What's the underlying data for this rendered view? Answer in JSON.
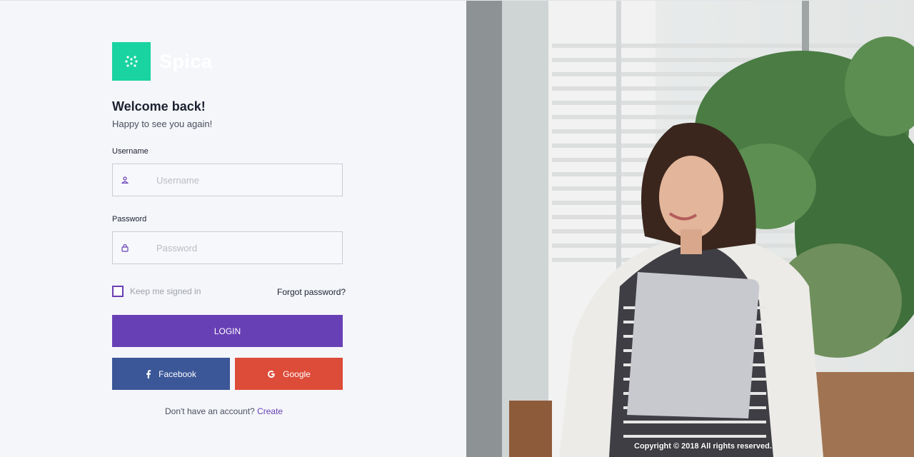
{
  "brand": {
    "name": "Spica",
    "logo_icon": "grid-dots-icon",
    "logo_color": "#19d3a0"
  },
  "welcome": {
    "title": "Welcome back!",
    "subtitle": "Happy to see you again!"
  },
  "username": {
    "label": "Username",
    "placeholder": "Username",
    "value": "",
    "icon": "user-icon"
  },
  "password": {
    "label": "Password",
    "placeholder": "Password",
    "value": "",
    "icon": "lock-icon"
  },
  "remember": {
    "label": "Keep me signed in",
    "checked": false
  },
  "forgot": {
    "label": "Forgot password?"
  },
  "login": {
    "label": "LOGIN",
    "color": "#6840b5"
  },
  "social": {
    "facebook": {
      "label": "Facebook",
      "icon": "facebook-icon",
      "color": "#3b5798"
    },
    "google": {
      "label": "Google",
      "icon": "google-icon",
      "color": "#dd4b39"
    }
  },
  "signup": {
    "prompt": "Don't have an account?",
    "link": "Create"
  },
  "hero": {
    "image": "woman-holding-laptop-photo"
  },
  "footer": {
    "copyright": "Copyright © 2018 All rights reserved."
  }
}
